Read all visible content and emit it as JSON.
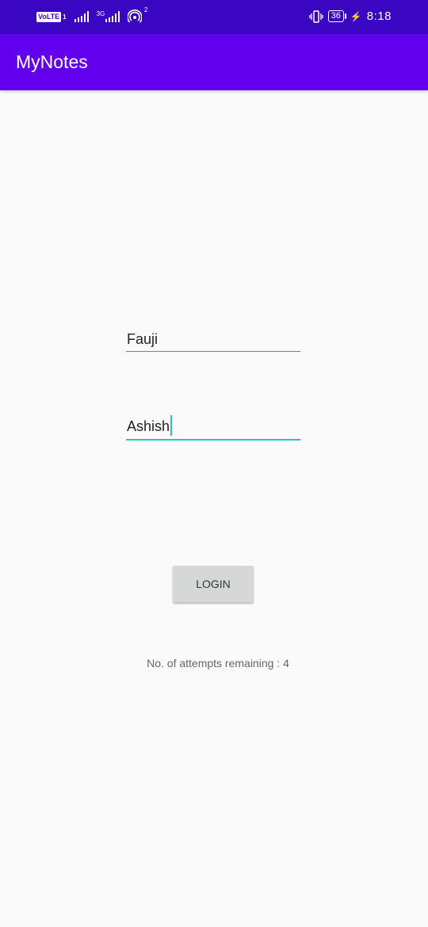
{
  "status_bar": {
    "volte": "VoLTE",
    "sim_badge": "1",
    "network_type": "3G",
    "hotspot_count": "2",
    "battery": "36",
    "time": "8:18",
    "icons": [
      "signal-icon",
      "signal-icon",
      "hotspot-icon",
      "vibrate-icon",
      "battery-icon",
      "charging-icon"
    ]
  },
  "app_bar": {
    "title": "MyNotes",
    "color": "#6200ee"
  },
  "form": {
    "username_value": "Fauji",
    "password_value": "Ashish",
    "login_label": "LOGIN",
    "accent_color": "#26c6bf"
  },
  "attempts_text": "No. of attempts remaining : 4"
}
